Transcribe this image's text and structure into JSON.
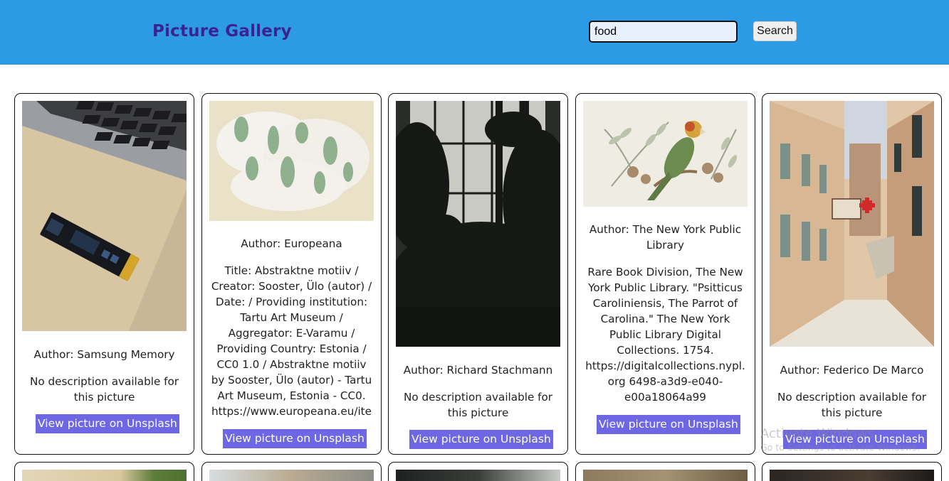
{
  "header": {
    "title": "Picture Gallery",
    "search_value": "food",
    "search_label": "Search"
  },
  "cards": [
    {
      "author": "Author: Samsung Memory",
      "description": "No description available for this picture",
      "link": "View picture on Unsplash"
    },
    {
      "author": "Author: Europeana",
      "description": "Title: Abstraktne motiiv / Creator: Sooster, Ülo (autor) / Date: / Providing institution: Tartu Art Museum / Aggregator: E-Varamu / Providing Country: Estonia / CC0 1.0 / Abstraktne motiiv by Sooster, Ülo (autor) - Tartu Art Museum, Estonia - CC0. https://www.europeana.eu/item",
      "link": "View picture on Unsplash"
    },
    {
      "author": "Author: Richard Stachmann",
      "description": "No description available for this picture",
      "link": "View picture on Unsplash"
    },
    {
      "author": "Author: The New York Public Library",
      "description": "Rare Book Division, The New York Public Library. \"Psitticus Caroliniensis, The Parrot of Carolina.\" The New York Public Library Digital Collections. 1754. https://digitalcollections.nypl.org 6498-a3d9-e040-e00a18064a99",
      "link": "View picture on Unsplash"
    },
    {
      "author": "Author: Federico De Marco",
      "description": "No description available for this picture",
      "link": "View picture on Unsplash"
    }
  ],
  "watermark": {
    "line1": "Activate Windows",
    "line2": "Go to Settings to activate Windows."
  }
}
